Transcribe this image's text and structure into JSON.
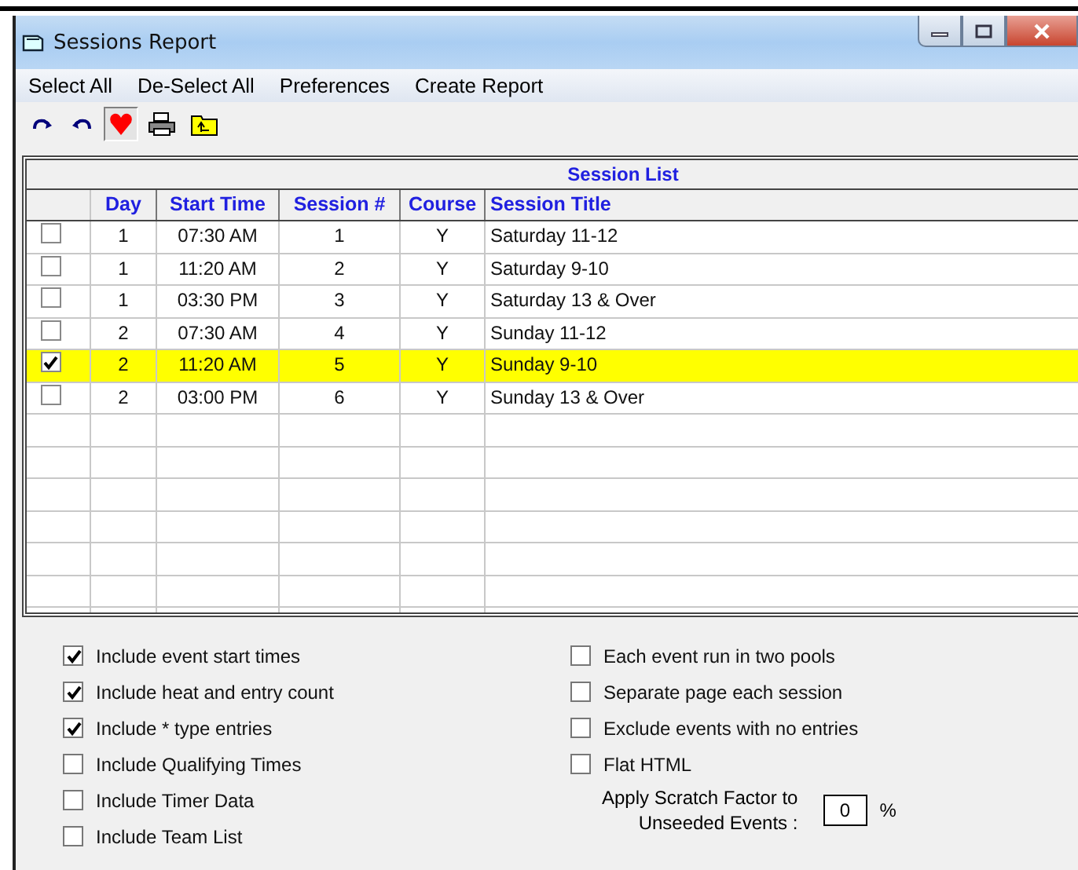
{
  "window": {
    "title": "Sessions Report"
  },
  "menu": [
    "Select All",
    "De-Select All",
    "Preferences",
    "Create Report"
  ],
  "toolbar": [
    {
      "kind": "redo",
      "pressed": false
    },
    {
      "kind": "undo",
      "pressed": false
    },
    {
      "kind": "heart",
      "pressed": true
    },
    {
      "kind": "print",
      "pressed": false
    },
    {
      "kind": "folder",
      "pressed": false
    }
  ],
  "table": {
    "title": "Session List",
    "columns": [
      "Day",
      "Start Time",
      "Session #",
      "Course",
      "Session Title"
    ],
    "rows": [
      {
        "checked": false,
        "selected": false,
        "cells": [
          "1",
          "07:30 AM",
          "1",
          "Y",
          "Saturday 11-12"
        ]
      },
      {
        "checked": false,
        "selected": false,
        "cells": [
          "1",
          "11:20 AM",
          "2",
          "Y",
          "Saturday 9-10"
        ]
      },
      {
        "checked": false,
        "selected": false,
        "cells": [
          "1",
          "03:30 PM",
          "3",
          "Y",
          "Saturday 13 & Over"
        ]
      },
      {
        "checked": false,
        "selected": false,
        "cells": [
          "2",
          "07:30 AM",
          "4",
          "Y",
          "Sunday 11-12"
        ]
      },
      {
        "checked": true,
        "selected": true,
        "cells": [
          "2",
          "11:20 AM",
          "5",
          "Y",
          "Sunday 9-10"
        ]
      },
      {
        "checked": false,
        "selected": false,
        "cells": [
          "2",
          "03:00 PM",
          "6",
          "Y",
          "Sunday 13 & Over"
        ]
      }
    ]
  },
  "options_left": [
    {
      "label": "Include event start times",
      "checked": true
    },
    {
      "label": "Include heat and entry count",
      "checked": true
    },
    {
      "label": "Include * type entries",
      "checked": true
    },
    {
      "label": "Include Qualifying Times",
      "checked": false
    },
    {
      "label": "Include Timer Data",
      "checked": false
    },
    {
      "label": "Include Team List",
      "checked": false
    }
  ],
  "options_right": [
    {
      "label": "Each event run in two pools",
      "checked": false
    },
    {
      "label": "Separate page each session",
      "checked": false
    },
    {
      "label": "Exclude events with no entries",
      "checked": false
    },
    {
      "label": "Flat HTML",
      "checked": false
    }
  ],
  "scratch": {
    "label_line1": "Apply Scratch Factor to",
    "label_line2": "Unseeded Events :",
    "value": "0",
    "unit": "%"
  }
}
